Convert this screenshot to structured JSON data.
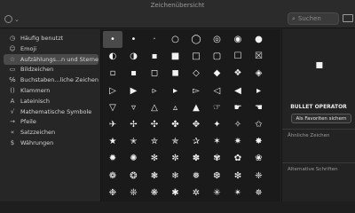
{
  "window": {
    "title": "Zeichenübersicht"
  },
  "toolbar": {
    "search_placeholder": "Suchen"
  },
  "sidebar": {
    "items": [
      {
        "label": "Häufig benutzt",
        "icon": "clock-icon",
        "glyph": "◷"
      },
      {
        "label": "Emoji",
        "icon": "smiley-icon",
        "glyph": "☺"
      },
      {
        "label": "Aufzählungs...n und Sterne",
        "icon": "star-outline-icon",
        "glyph": "☆"
      },
      {
        "label": "Bildzeichen",
        "icon": "picture-icon",
        "glyph": "▭"
      },
      {
        "label": "Buchstaben...liche Zeichen",
        "icon": "letter-symbol-icon",
        "glyph": "℅"
      },
      {
        "label": "Klammern",
        "icon": "brackets-icon",
        "glyph": "()"
      },
      {
        "label": "Lateinisch",
        "icon": "latin-a-icon",
        "glyph": "A"
      },
      {
        "label": "Mathematische Symbole",
        "icon": "math-icon",
        "glyph": "√"
      },
      {
        "label": "Pfeile",
        "icon": "arrow-icon",
        "glyph": "→"
      },
      {
        "label": "Satzzeichen",
        "icon": "punctuation-icon",
        "glyph": "«"
      },
      {
        "label": "Währungen",
        "icon": "currency-icon",
        "glyph": "$"
      }
    ]
  },
  "grid": {
    "rows": [
      [
        "•",
        "•",
        "·",
        "○",
        "◯",
        "◎",
        "◉",
        "●"
      ],
      [
        "◐",
        "◑",
        "▪",
        "■",
        "□",
        "▢",
        "☐",
        "☒"
      ],
      [
        "▫",
        "▪",
        "◻",
        "◼",
        "◇",
        "◆",
        "❖",
        "◈"
      ],
      [
        "▷",
        "▶",
        "▹",
        "▸",
        "▻",
        "◁",
        "◀",
        "▸"
      ],
      [
        "▽",
        "▿",
        "△",
        "▵",
        "▲",
        "☞",
        "☛",
        "☚"
      ],
      [
        "✈",
        "✢",
        "✣",
        "✤",
        "✥",
        "✦",
        "✧",
        "✩"
      ],
      [
        "★",
        "✭",
        "✮",
        "✯",
        "✰",
        "✶",
        "✷",
        "✸"
      ],
      [
        "✹",
        "✺",
        "✻",
        "✼",
        "✽",
        "✾",
        "✿",
        "❀"
      ],
      [
        "❁",
        "❂",
        "❃",
        "❄",
        "❅",
        "❆",
        "❇",
        "❈"
      ],
      [
        "❉",
        "❊",
        "❋",
        "✱",
        "✲",
        "✳",
        "✴",
        "✵"
      ]
    ]
  },
  "panel": {
    "preview_glyph": "▪",
    "char_name": "BULLET OPERATOR",
    "favorite_button": "Als Favoriten sichern",
    "similar_label": "Ähnliche Zeichen",
    "alt_fonts_label": "Alternative Schriften"
  }
}
